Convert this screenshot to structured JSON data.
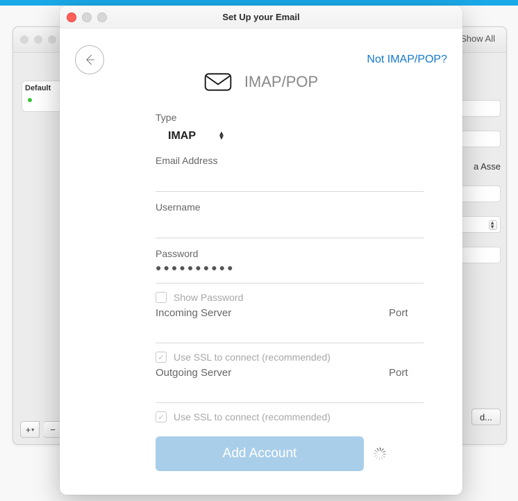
{
  "back": {
    "showall": "Show All",
    "default_label": "Default",
    "right_stub_text": "a Asse",
    "bottom_right": "d...",
    "plus": "+",
    "minus": "−"
  },
  "modal": {
    "title": "Set Up your Email",
    "help_link": "Not IMAP/POP?",
    "brand_label": "IMAP/POP",
    "form": {
      "type_label": "Type",
      "type_value": "IMAP",
      "email_label": "Email Address",
      "email_value": "",
      "username_label": "Username",
      "username_value": "",
      "password_label": "Password",
      "password_mask": "●●●●●●●●●●",
      "show_password_label": "Show Password",
      "incoming_label": "Incoming Server",
      "port_label": "Port",
      "incoming_host": "",
      "incoming_port": "",
      "incoming_ssl_label": "Use SSL to connect (recommended)",
      "outgoing_label": "Outgoing Server",
      "outgoing_host": "",
      "outgoing_port": "",
      "outgoing_ssl_label": "Use SSL to connect (recommended)",
      "submit_label": "Add Account"
    }
  }
}
